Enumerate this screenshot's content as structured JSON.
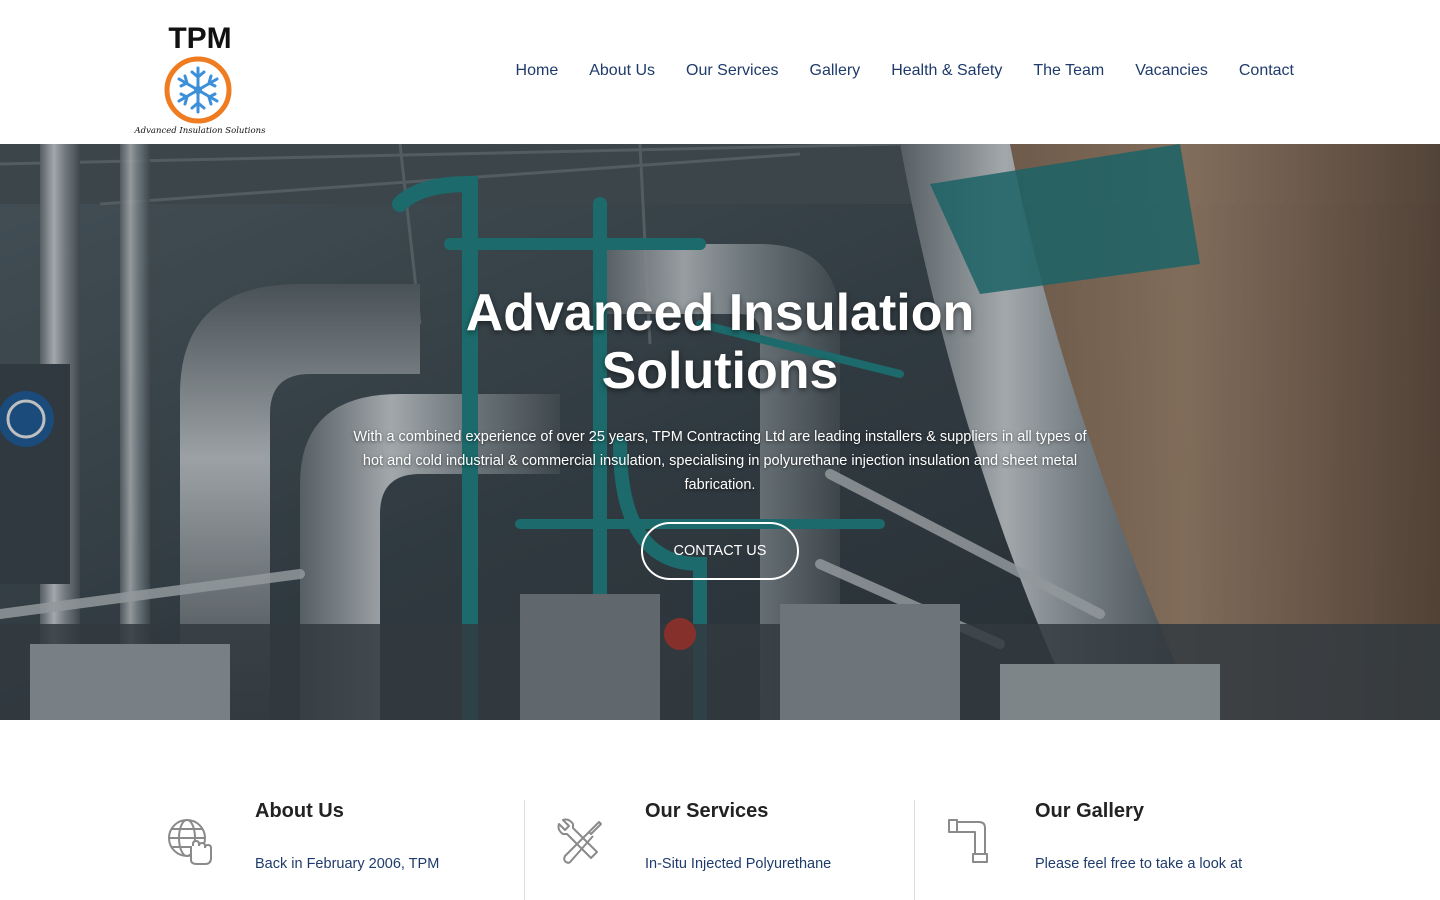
{
  "logo": {
    "name": "TPM",
    "tagline": "Advanced Insulation Solutions"
  },
  "nav": {
    "items": [
      "Home",
      "About Us",
      "Our Services",
      "Gallery",
      "Health & Safety",
      "The Team",
      "Vacancies",
      "Contact"
    ]
  },
  "hero": {
    "title_line1": "Advanced Insulation",
    "title_line2": "Solutions",
    "text_line1": "With a combined experience of over 25 years, TPM Contracting Ltd are leading installers & suppliers in all types of",
    "text_line2": "hot and cold industrial & commercial insulation, specialising in polyurethane injection insulation and sheet metal",
    "text_line3": "fabrication.",
    "button": "CONTACT US"
  },
  "features": [
    {
      "icon": "globe-hand-icon",
      "title": "About Us",
      "text": "Back in February 2006, TPM"
    },
    {
      "icon": "tools-icon",
      "title": "Our Services",
      "text": "In-Situ Injected Polyurethane"
    },
    {
      "icon": "pipe-icon",
      "title": "Our Gallery",
      "text": "Please feel free to take a look at"
    }
  ],
  "colors": {
    "nav_text": "#1f3b6b",
    "logo_orange": "#f07c22",
    "logo_blue": "#3c8fd9"
  }
}
